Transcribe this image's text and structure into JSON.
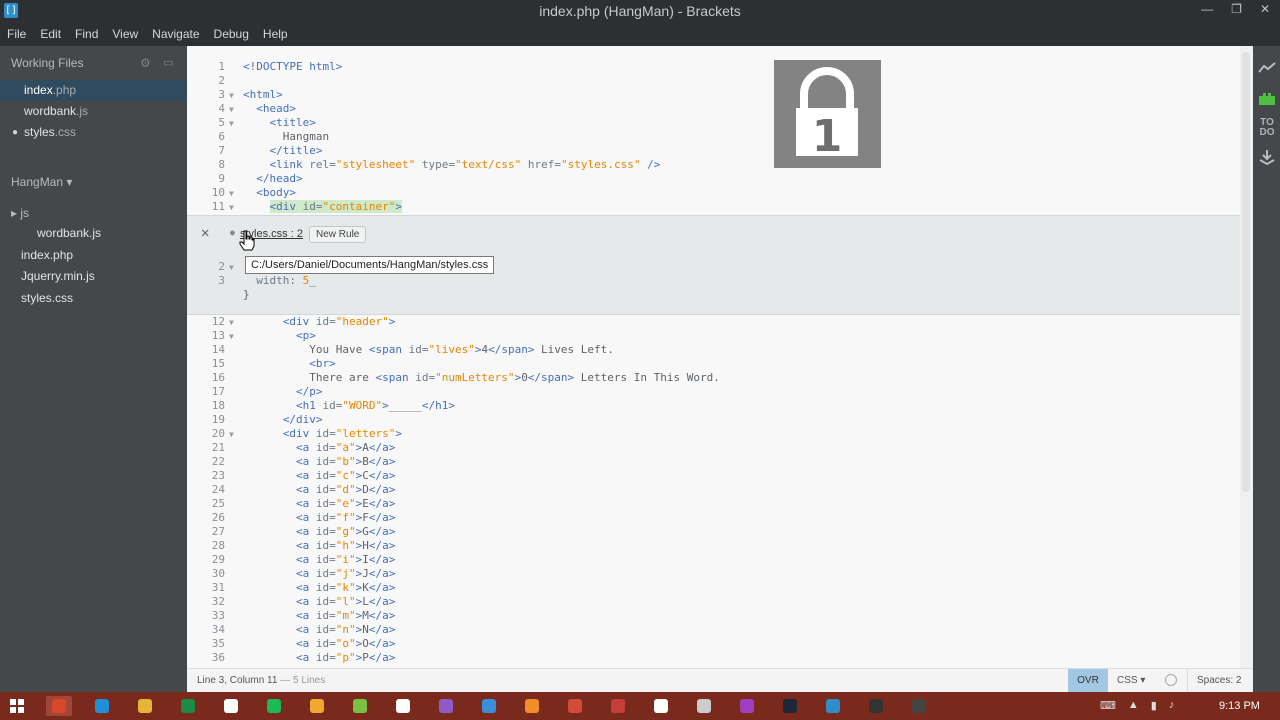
{
  "window": {
    "title": "index.php (HangMan) - Brackets",
    "app_icon": "[]",
    "minimize": "—",
    "maximize": "❐",
    "close": "✕"
  },
  "menu": [
    "File",
    "Edit",
    "Find",
    "View",
    "Navigate",
    "Debug",
    "Help"
  ],
  "sidebar": {
    "working_files_title": "Working Files",
    "working_files": [
      {
        "name": "index",
        "ext": ".php",
        "active": true,
        "dirty": false
      },
      {
        "name": "wordbank",
        "ext": ".js",
        "active": false,
        "dirty": false
      },
      {
        "name": "styles",
        "ext": ".css",
        "active": false,
        "dirty": true
      }
    ],
    "project_title": "HangMan ▾",
    "tree": [
      {
        "label": "▸ js",
        "indent": 0
      },
      {
        "label": "wordbank.js",
        "indent": 1
      },
      {
        "label": "index.php",
        "indent": 0
      },
      {
        "label": "Jquerry.min.js",
        "indent": 0
      },
      {
        "label": "styles.css",
        "indent": 0
      }
    ]
  },
  "editor": {
    "top_lines": [
      {
        "n": "1",
        "fold": "",
        "html": "<span class=\"tag\">&lt;!DOCTYPE html&gt;</span>"
      },
      {
        "n": "2",
        "fold": "",
        "html": ""
      },
      {
        "n": "3",
        "fold": "▼",
        "html": "<span class=\"tag\">&lt;html&gt;</span>"
      },
      {
        "n": "4",
        "fold": "▼",
        "html": "  <span class=\"tag\">&lt;head&gt;</span>"
      },
      {
        "n": "5",
        "fold": "▼",
        "html": "    <span class=\"tag\">&lt;title&gt;</span>"
      },
      {
        "n": "6",
        "fold": "",
        "html": "      Hangman"
      },
      {
        "n": "7",
        "fold": "",
        "html": "    <span class=\"tag\">&lt;/title&gt;</span>"
      },
      {
        "n": "8",
        "fold": "",
        "html": "    <span class=\"tag\">&lt;link</span> <span class=\"attr\">rel=</span><span class=\"str\">\"stylesheet\"</span> <span class=\"attr\">type=</span><span class=\"str\">\"text/css\"</span> <span class=\"attr\">href=</span><span class=\"str\">\"styles.css\"</span> <span class=\"tag\">/&gt;</span>"
      },
      {
        "n": "9",
        "fold": "",
        "html": "  <span class=\"tag\">&lt;/head&gt;</span>"
      },
      {
        "n": "10",
        "fold": "▼",
        "html": "  <span class=\"tag\">&lt;body&gt;</span>"
      },
      {
        "n": "11",
        "fold": "▼",
        "html": "    <span class=\"hl\"><span class=\"tag\">&lt;div</span> <span class=\"attr\">id=</span><span class=\"str\">\"container\"</span><span class=\"tag\">&gt;</span></span>"
      }
    ],
    "inline": {
      "file": "styles.css : 2",
      "new_rule": "New Rule",
      "tooltip": "C:/Users/Daniel/Documents/HangMan/styles.css",
      "lines": [
        {
          "n": "2",
          "fold": "▼",
          "html": ""
        },
        {
          "n": "3",
          "fold": "",
          "html": "  <span class=\"attr\">width:</span> <span class=\"str\">5</span>_"
        },
        {
          "n": "",
          "fold": "",
          "html": "}"
        }
      ]
    },
    "bottom_lines": [
      {
        "n": "12",
        "fold": "▼",
        "html": "      <span class=\"tag\">&lt;div</span> <span class=\"attr\">id=</span><span class=\"str\">\"header\"</span><span class=\"tag\">&gt;</span>"
      },
      {
        "n": "13",
        "fold": "▼",
        "html": "        <span class=\"tag\">&lt;p&gt;</span>"
      },
      {
        "n": "14",
        "fold": "",
        "html": "          You Have <span class=\"tag\">&lt;span</span> <span class=\"attr\">id=</span><span class=\"str\">\"lives\"</span><span class=\"tag\">&gt;</span>4<span class=\"tag\">&lt;/span&gt;</span> Lives Left."
      },
      {
        "n": "15",
        "fold": "",
        "html": "          <span class=\"tag\">&lt;br&gt;</span>"
      },
      {
        "n": "16",
        "fold": "",
        "html": "          There are <span class=\"tag\">&lt;span</span> <span class=\"attr\">id=</span><span class=\"str\">\"numLetters\"</span><span class=\"tag\">&gt;</span>0<span class=\"tag\">&lt;/span&gt;</span> Letters In This Word."
      },
      {
        "n": "17",
        "fold": "",
        "html": "        <span class=\"tag\">&lt;/p&gt;</span>"
      },
      {
        "n": "18",
        "fold": "",
        "html": "        <span class=\"tag\">&lt;h1</span> <span class=\"attr\">id=</span><span class=\"str\">\"WORD\"</span><span class=\"tag\">&gt;</span>_____<span class=\"tag\">&lt;/h1&gt;</span>"
      },
      {
        "n": "19",
        "fold": "",
        "html": "      <span class=\"tag\">&lt;/div&gt;</span>"
      },
      {
        "n": "20",
        "fold": "▼",
        "html": "      <span class=\"tag\">&lt;div</span> <span class=\"attr\">id=</span><span class=\"str\">\"letters\"</span><span class=\"tag\">&gt;</span>"
      },
      {
        "n": "21",
        "fold": "",
        "html": "        <span class=\"tag\">&lt;a</span> <span class=\"attr\">id=</span><span class=\"str\">\"a\"</span><span class=\"tag\">&gt;</span>A<span class=\"tag\">&lt;/a&gt;</span>"
      },
      {
        "n": "22",
        "fold": "",
        "html": "        <span class=\"tag\">&lt;a</span> <span class=\"attr\">id=</span><span class=\"str\">\"b\"</span><span class=\"tag\">&gt;</span>B<span class=\"tag\">&lt;/a&gt;</span>"
      },
      {
        "n": "23",
        "fold": "",
        "html": "        <span class=\"tag\">&lt;a</span> <span class=\"attr\">id=</span><span class=\"str\">\"c\"</span><span class=\"tag\">&gt;</span>C<span class=\"tag\">&lt;/a&gt;</span>"
      },
      {
        "n": "24",
        "fold": "",
        "html": "        <span class=\"tag\">&lt;a</span> <span class=\"attr\">id=</span><span class=\"str\">\"d\"</span><span class=\"tag\">&gt;</span>D<span class=\"tag\">&lt;/a&gt;</span>"
      },
      {
        "n": "25",
        "fold": "",
        "html": "        <span class=\"tag\">&lt;a</span> <span class=\"attr\">id=</span><span class=\"str\">\"e\"</span><span class=\"tag\">&gt;</span>E<span class=\"tag\">&lt;/a&gt;</span>"
      },
      {
        "n": "26",
        "fold": "",
        "html": "        <span class=\"tag\">&lt;a</span> <span class=\"attr\">id=</span><span class=\"str\">\"f\"</span><span class=\"tag\">&gt;</span>F<span class=\"tag\">&lt;/a&gt;</span>"
      },
      {
        "n": "27",
        "fold": "",
        "html": "        <span class=\"tag\">&lt;a</span> <span class=\"attr\">id=</span><span class=\"str\">\"g\"</span><span class=\"tag\">&gt;</span>G<span class=\"tag\">&lt;/a&gt;</span>"
      },
      {
        "n": "28",
        "fold": "",
        "html": "        <span class=\"tag\">&lt;a</span> <span class=\"attr\">id=</span><span class=\"str\">\"h\"</span><span class=\"tag\">&gt;</span>H<span class=\"tag\">&lt;/a&gt;</span>"
      },
      {
        "n": "29",
        "fold": "",
        "html": "        <span class=\"tag\">&lt;a</span> <span class=\"attr\">id=</span><span class=\"str\">\"i\"</span><span class=\"tag\">&gt;</span>I<span class=\"tag\">&lt;/a&gt;</span>"
      },
      {
        "n": "30",
        "fold": "",
        "html": "        <span class=\"tag\">&lt;a</span> <span class=\"attr\">id=</span><span class=\"str\">\"j\"</span><span class=\"tag\">&gt;</span>J<span class=\"tag\">&lt;/a&gt;</span>"
      },
      {
        "n": "31",
        "fold": "",
        "html": "        <span class=\"tag\">&lt;a</span> <span class=\"attr\">id=</span><span class=\"str\">\"k\"</span><span class=\"tag\">&gt;</span>K<span class=\"tag\">&lt;/a&gt;</span>"
      },
      {
        "n": "32",
        "fold": "",
        "html": "        <span class=\"tag\">&lt;a</span> <span class=\"attr\">id=</span><span class=\"str\">\"l\"</span><span class=\"tag\">&gt;</span>L<span class=\"tag\">&lt;/a&gt;</span>"
      },
      {
        "n": "33",
        "fold": "",
        "html": "        <span class=\"tag\">&lt;a</span> <span class=\"attr\">id=</span><span class=\"str\">\"m\"</span><span class=\"tag\">&gt;</span>M<span class=\"tag\">&lt;/a&gt;</span>"
      },
      {
        "n": "34",
        "fold": "",
        "html": "        <span class=\"tag\">&lt;a</span> <span class=\"attr\">id=</span><span class=\"str\">\"n\"</span><span class=\"tag\">&gt;</span>N<span class=\"tag\">&lt;/a&gt;</span>"
      },
      {
        "n": "35",
        "fold": "",
        "html": "        <span class=\"tag\">&lt;a</span> <span class=\"attr\">id=</span><span class=\"str\">\"o\"</span><span class=\"tag\">&gt;</span>O<span class=\"tag\">&lt;/a&gt;</span>"
      },
      {
        "n": "36",
        "fold": "",
        "html": "        <span class=\"tag\">&lt;a</span> <span class=\"attr\">id=</span><span class=\"str\">\"p\"</span><span class=\"tag\">&gt;</span>P<span class=\"tag\">&lt;/a&gt;</span>"
      }
    ]
  },
  "rightbar_icons": [
    "live-preview-icon",
    "extension-manager-icon",
    "todo-icon",
    "deploy-icon"
  ],
  "rightbar_todo": "TO\nDO",
  "status": {
    "position": "Line 3, Column 11",
    "lines": " — 5 Lines",
    "mode": "OVR",
    "language": "CSS ▾",
    "spaces": "Spaces: 2"
  },
  "taskbar": {
    "clock": "9:13 PM",
    "icons": [
      "chrome-icon",
      "ie-icon",
      "explorer-icon",
      "excel-icon",
      "home-icon",
      "spotify-icon",
      "app-icon",
      "evernote-icon",
      "amazon-icon",
      "visual-studio-icon",
      "vs-code-icon",
      "user-icon",
      "media-icon",
      "presentation-icon",
      "calculator-icon",
      "game-icon",
      "purple-app-icon",
      "steam-icon",
      "brackets-icon",
      "terminal-icon",
      "settings-icon"
    ]
  }
}
